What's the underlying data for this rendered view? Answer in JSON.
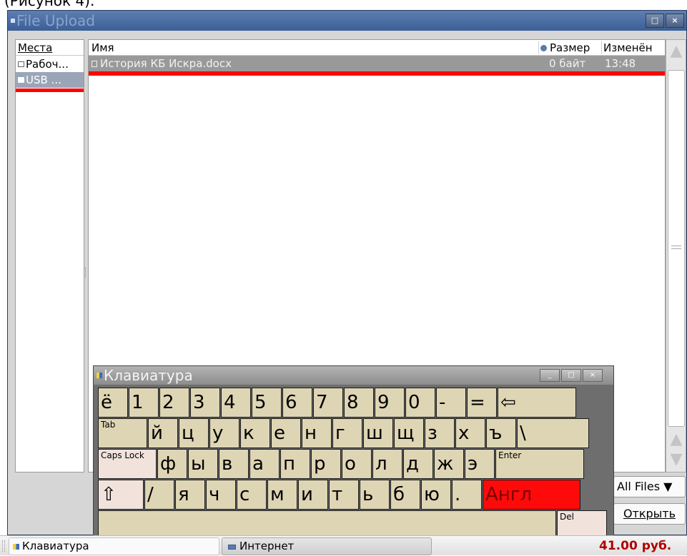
{
  "top_caption": "(Рисунок 4).",
  "window": {
    "title": "File Upload",
    "controls": {
      "maximize": "□",
      "close": "×"
    }
  },
  "places": {
    "header": "Места",
    "items": [
      {
        "label": "Рабоч...",
        "icon": "folder-icon"
      },
      {
        "label": "USB ...",
        "icon": "drive-icon",
        "selected": true
      }
    ]
  },
  "files": {
    "columns": {
      "name": "Имя",
      "size": "Размер",
      "modified": "Изменён"
    },
    "rows": [
      {
        "name": "История КБ Искра.docx",
        "size": "0 байт",
        "modified": "13:48",
        "selected": true
      }
    ]
  },
  "scrollbar": {
    "up": "▲",
    "down": "▼"
  },
  "filter": {
    "label": "All Files ▼"
  },
  "open_button": "Открыть",
  "keyboard": {
    "title": "Клавиатура",
    "controls": {
      "minimize": "_",
      "maximize": "□",
      "close": "×"
    },
    "rows": [
      [
        "ё",
        "1",
        "2",
        "3",
        "4",
        "5",
        "6",
        "7",
        "8",
        "9",
        "0",
        "-",
        "=",
        "⇦"
      ],
      [
        "Tab",
        "й",
        "ц",
        "у",
        "к",
        "е",
        "н",
        "г",
        "ш",
        "щ",
        "з",
        "х",
        "ъ",
        "\\"
      ],
      [
        "Caps Lock",
        "ф",
        "ы",
        "в",
        "а",
        "п",
        "р",
        "о",
        "л",
        "д",
        "ж",
        "э",
        "Enter"
      ],
      [
        "⇧",
        "/",
        "я",
        "ч",
        "с",
        "м",
        "и",
        "т",
        "ь",
        "б",
        "ю",
        ".",
        "Англ"
      ],
      [
        "",
        "Del"
      ]
    ]
  },
  "taskbar": {
    "items": [
      {
        "label": "Клавиатура",
        "active": true
      },
      {
        "label": "Интернет",
        "active": false
      }
    ],
    "balance": "41.00 руб."
  }
}
